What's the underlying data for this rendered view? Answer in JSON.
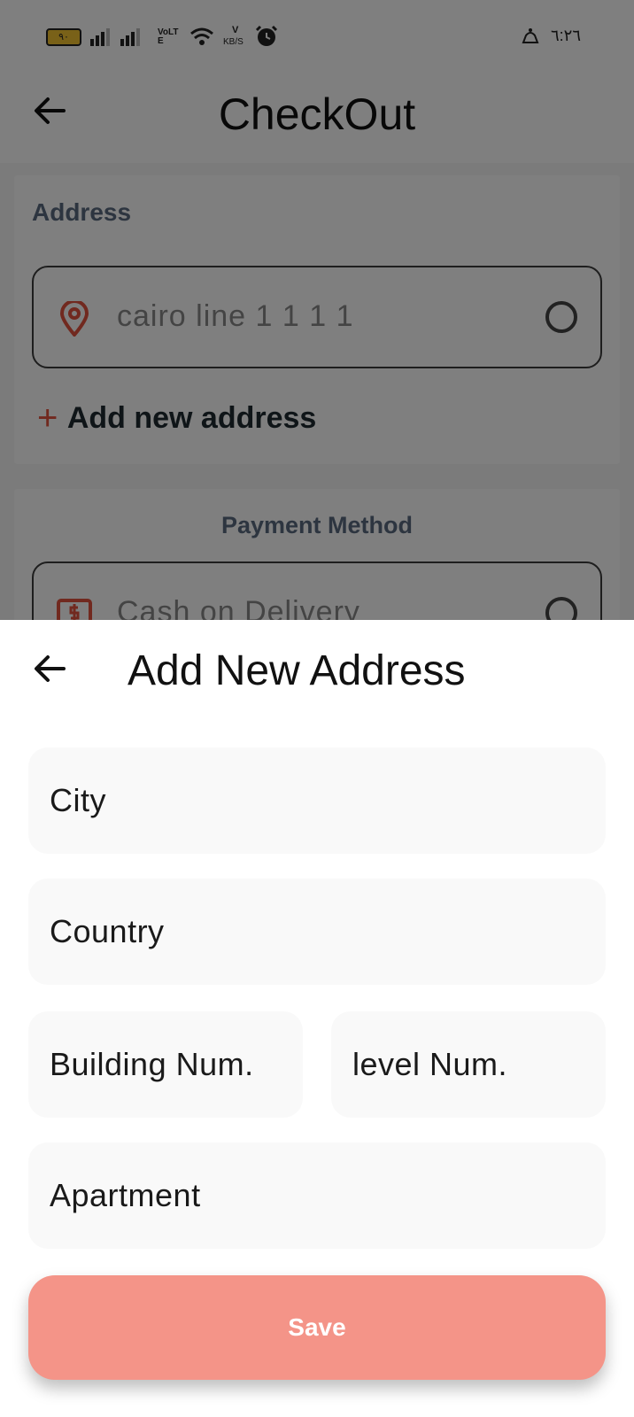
{
  "status_bar": {
    "battery_level": "٩٠",
    "network_type": "VoLTE",
    "speed_value": "V",
    "speed_unit": "KB/S",
    "time": "٦:٢٦"
  },
  "checkout": {
    "title": "CheckOut",
    "address_section": {
      "label": "Address",
      "saved_address": "cairo line 1 1 1 1",
      "add_new_label": "Add new address",
      "add_new_prefix": "+"
    },
    "payment_section": {
      "label": "Payment Method",
      "option": "Cash on Delivery"
    }
  },
  "sheet": {
    "title": "Add New Address",
    "fields": {
      "city": "City",
      "country": "Country",
      "building": "Building Num.",
      "level": "level Num.",
      "apartment": "Apartment"
    },
    "save_label": "Save"
  },
  "colors": {
    "accent": "#f49488",
    "field_bg": "#f9f9f9",
    "pin": "#e2523f"
  },
  "icons": [
    "back-arrow-icon",
    "location-pin-icon",
    "cash-icon",
    "radio-icon",
    "plus-icon",
    "battery-icon",
    "signal-icon",
    "wifi-icon",
    "alarm-icon",
    "notification-icon"
  ]
}
